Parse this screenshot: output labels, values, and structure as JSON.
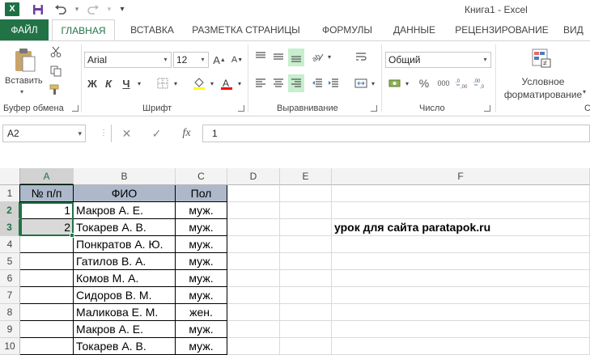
{
  "titlebar": {
    "title": "Книга1 - Excel",
    "logo_letter": "X",
    "icons": [
      "excel-logo",
      "save-icon",
      "undo-icon",
      "redo-icon",
      "customize-quick-access-icon"
    ]
  },
  "tabs": [
    "ФАЙЛ",
    "ГЛАВНАЯ",
    "ВСТАВКА",
    "РАЗМЕТКА СТРАНИЦЫ",
    "ФОРМУЛЫ",
    "ДАННЫЕ",
    "РЕЦЕНЗИРОВАНИЕ",
    "ВИД"
  ],
  "ribbon": {
    "paste_label": "Вставить",
    "clipboard_label": "Буфер обмена",
    "font_name": "Arial",
    "font_size": "12",
    "bold": "Ж",
    "italic": "К",
    "underline": "Ч",
    "font_group_label": "Шрифт",
    "alignment_label": "Выравнивание",
    "number_format": "Общий",
    "number_label": "Число",
    "cond_format_line1": "Условное",
    "cond_format_line2": "форматирование"
  },
  "formula_bar": {
    "name_box": "A2",
    "cancel": "✕",
    "enter": "✓",
    "fx": "fx",
    "formula": "1"
  },
  "grid": {
    "columns": [
      "A",
      "B",
      "C",
      "D",
      "E",
      "F"
    ],
    "rows": [
      "1",
      "2",
      "3",
      "4",
      "5",
      "6",
      "7",
      "8",
      "9",
      "10"
    ],
    "header": [
      "№ п/п",
      "ФИО",
      "Пол"
    ],
    "data": [
      [
        "1",
        "Макров А. Е.",
        "муж."
      ],
      [
        "2",
        "Токарев А. В.",
        "муж."
      ],
      [
        "",
        "Понкратов А. Ю.",
        "муж."
      ],
      [
        "",
        "Гатилов В. А.",
        "муж."
      ],
      [
        "",
        "Комов М. А.",
        "муж."
      ],
      [
        "",
        "Сидоров В. М.",
        "муж."
      ],
      [
        "",
        "Маликова Е. М.",
        "жен."
      ],
      [
        "",
        "Макров А. Е.",
        "муж."
      ],
      [
        "",
        "Токарев А. В.",
        "муж."
      ]
    ],
    "note": "урок для сайта paratapok.ru",
    "active_cell": "A2",
    "header_fill": "#adb9ca",
    "selection_color": "#217346"
  }
}
